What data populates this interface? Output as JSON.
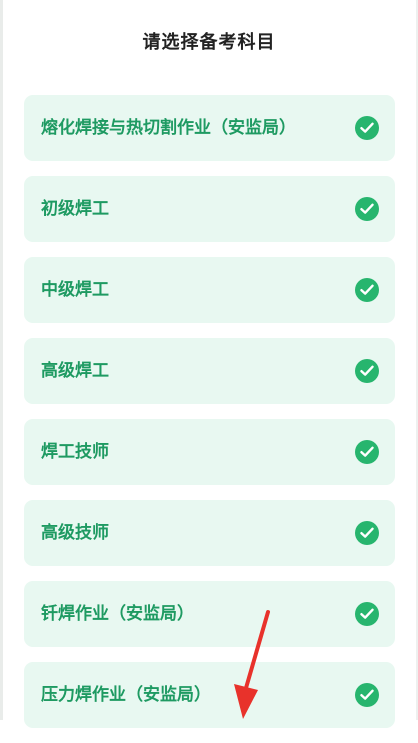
{
  "page": {
    "title": "请选择备考科目"
  },
  "subjects": [
    {
      "label": "熔化焊接与热切割作业（安监局）",
      "selected": true
    },
    {
      "label": "初级焊工",
      "selected": true
    },
    {
      "label": "中级焊工",
      "selected": true
    },
    {
      "label": "高级焊工",
      "selected": true
    },
    {
      "label": "焊工技师",
      "selected": true
    },
    {
      "label": "高级技师",
      "selected": true
    },
    {
      "label": "钎焊作业（安监局）",
      "selected": true
    },
    {
      "label": "压力焊作业（安监局）",
      "selected": true
    }
  ],
  "colors": {
    "item_background": "#e8f8f1",
    "item_text": "#1e9a62",
    "check_fill": "#27b56e",
    "annotation_arrow": "#e8322b"
  },
  "icons": {
    "check": "check-circle-icon",
    "annotation": "red-arrow-pointer"
  }
}
